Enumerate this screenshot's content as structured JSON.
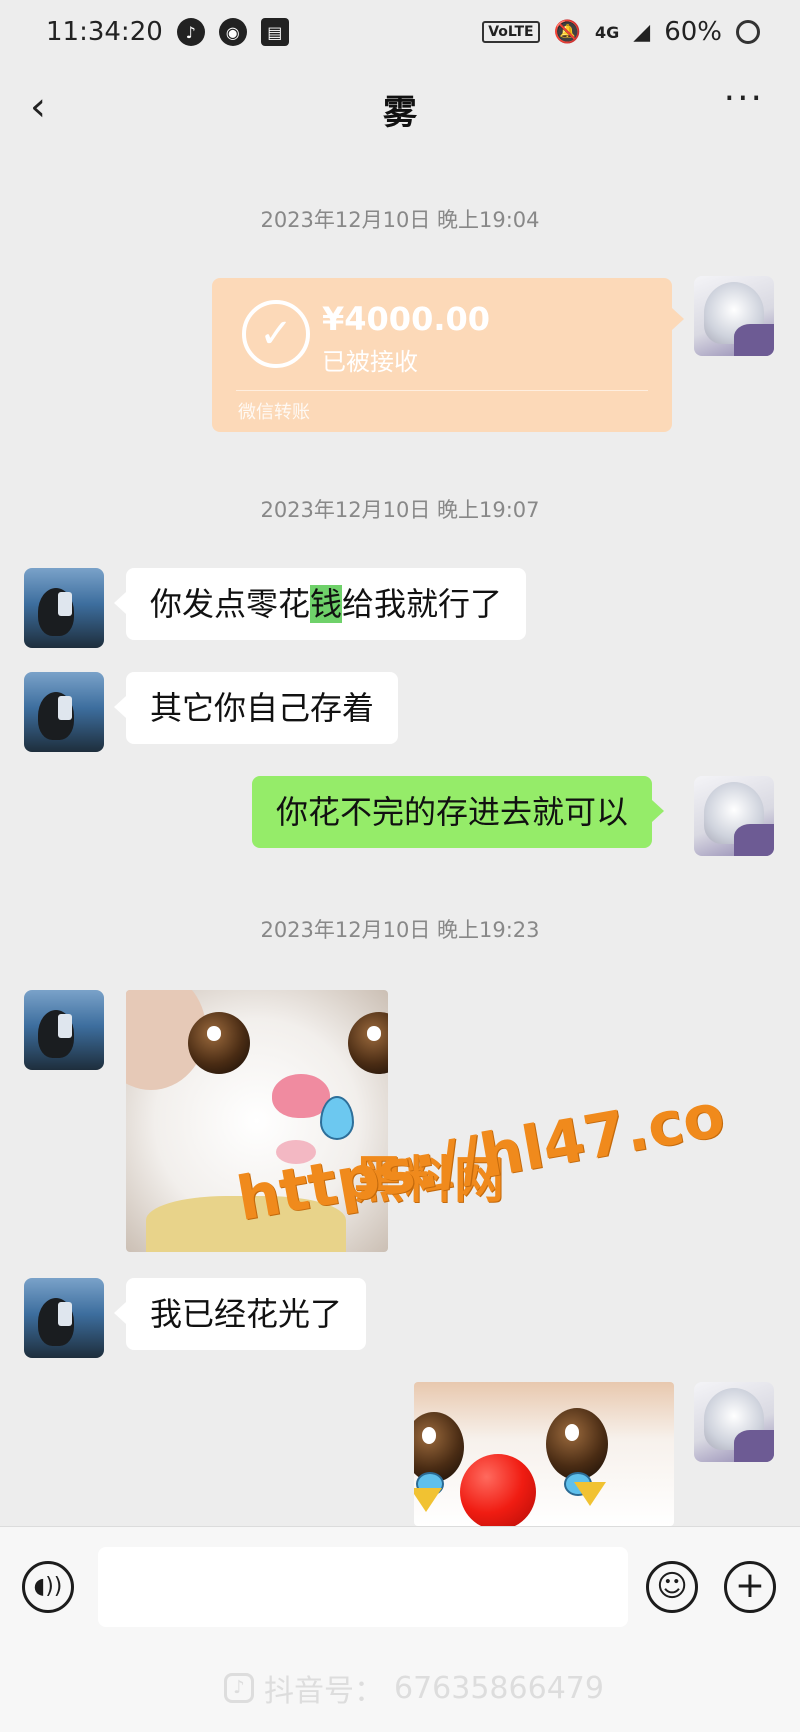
{
  "status_bar": {
    "time": "11:34:20",
    "network": "VoLTE",
    "signal": "4G",
    "battery": "60%"
  },
  "header": {
    "title": "雾",
    "back_icon": "chevron-left-icon",
    "more_icon": "more-dots-icon",
    "more_label": "···"
  },
  "messages": {
    "ts1": "2023年12月10日 晚上19:04",
    "transfer": {
      "amount": "¥4000.00",
      "status": "已被接收",
      "footer": "微信转账"
    },
    "ts2": "2023年12月10日 晚上19:07",
    "m1_a": "你发点零花",
    "m1_hl": "钱",
    "m1_b": "给我就行了",
    "m2": "其它你自己存着",
    "m3": "你花不完的存进去就可以",
    "ts3": "2023年12月10日 晚上19:23",
    "m4": "我已经花光了"
  },
  "watermark": {
    "site_name": "黑料网",
    "site_url": "https://hl47.co"
  },
  "input_bar": {
    "value": "",
    "placeholder": "",
    "voice_icon": "voice-icon",
    "emoji_icon": "emoji-icon",
    "plus_icon": "plus-icon"
  },
  "footer_watermark": {
    "label": "抖音号：",
    "id": "67635866479"
  },
  "colors": {
    "background": "#ededed",
    "sent_bubble": "#95ec69",
    "received_bubble": "#ffffff",
    "transfer_card": "#fcd9b8",
    "watermark": "#f08a1c"
  }
}
